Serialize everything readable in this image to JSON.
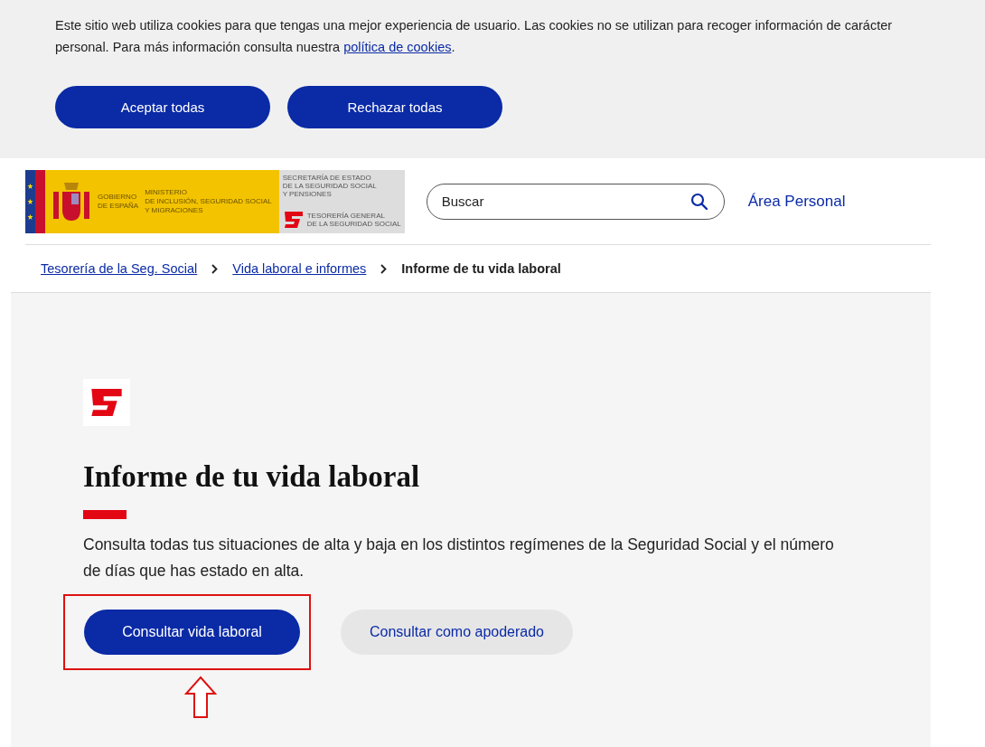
{
  "cookie_banner": {
    "text": "Este sitio web utiliza cookies para que tengas una mejor experiencia de usuario. Las cookies no se utilizan para recoger información de carácter personal. Para más información consulta nuestra ",
    "link": "política de cookies",
    "text_end": ".",
    "buttons": [
      "Aceptar todas",
      "Rechazar todas"
    ]
  },
  "header": {
    "logo": {
      "gov": [
        "GOBIERNO",
        "DE ESPAÑA"
      ],
      "ministry": [
        "MINISTERIO",
        "DE INCLUSIÓN, SEGURIDAD SOCIAL",
        "Y MIGRACIONES"
      ],
      "secretariat": [
        "SECRETARÍA DE ESTADO",
        "DE LA SEGURIDAD SOCIAL",
        "Y PENSIONES"
      ],
      "agency": [
        "TESORERÍA GENERAL",
        "DE LA SEGURIDAD SOCIAL"
      ]
    },
    "search": {
      "placeholder": "Buscar"
    },
    "personal_link": "Área Personal"
  },
  "breadcrumb": [
    {
      "label": "Tesorería de la Seg. Social",
      "current": false
    },
    {
      "label": "Vida laboral e informes",
      "current": false
    },
    {
      "label": "Informe de tu vida laboral",
      "current": true
    }
  ],
  "content": {
    "title": "Informe de tu vida laboral",
    "description": "Consulta todas tus situaciones de alta y baja en los distintos regímenes de la Seguridad Social y el número de días que has estado en alta.",
    "buttons": [
      {
        "label": "Consultar vida laboral",
        "kind": "primary",
        "highlighted": true
      },
      {
        "label": "Consultar como apoderado",
        "kind": "secondary",
        "highlighted": false
      }
    ]
  }
}
